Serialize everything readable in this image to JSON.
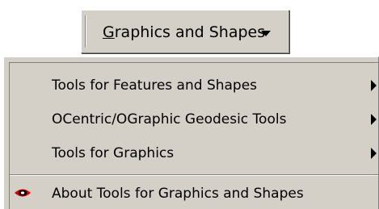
{
  "toolbar": {
    "menu_button": {
      "accelerator": "G",
      "label_rest": "raphics and Shapes"
    }
  },
  "dropdown": {
    "items": [
      {
        "label": "Tools for Features and Shapes",
        "has_submenu": true
      },
      {
        "label": "OCentric/OGraphic Geodesic Tools",
        "has_submenu": true
      },
      {
        "label": "Tools for Graphics",
        "has_submenu": true
      },
      {
        "label": "About Tools for Graphics and Shapes",
        "has_submenu": false,
        "icon": "eye-icon"
      }
    ]
  },
  "colors": {
    "face": "#d4d0c8",
    "highlight": "#ffffff",
    "shadow": "#808080",
    "icon_red": "#e00000",
    "icon_black": "#000000"
  }
}
